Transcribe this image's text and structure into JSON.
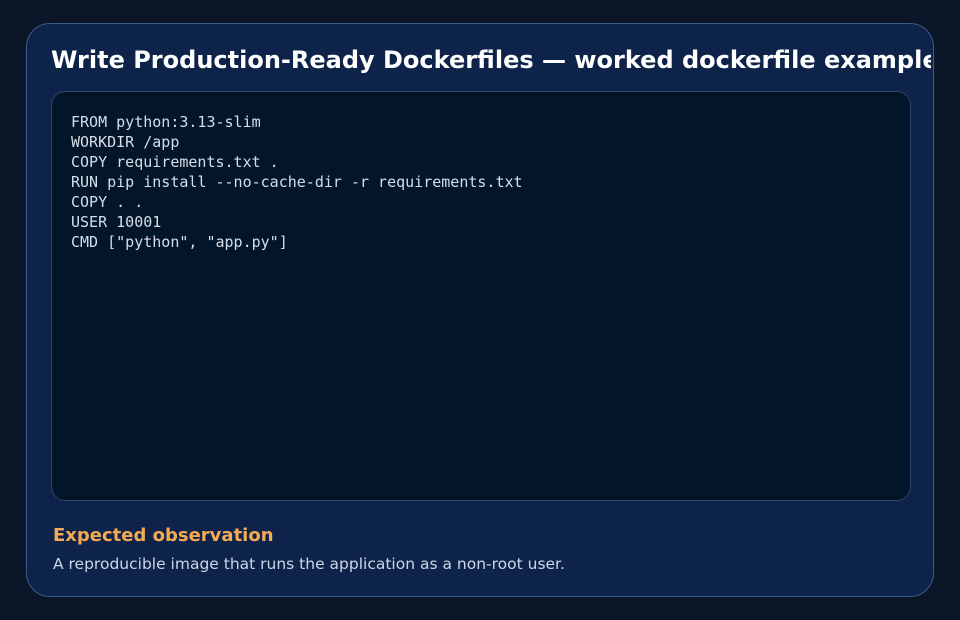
{
  "card": {
    "title": "Write Production-Ready Dockerfiles — worked dockerfile example"
  },
  "code": {
    "lines": [
      "FROM python:3.13-slim",
      "WORKDIR /app",
      "COPY requirements.txt .",
      "RUN pip install --no-cache-dir -r requirements.txt",
      "COPY . .",
      "USER 10001",
      "CMD [\"python\", \"app.py\"]"
    ]
  },
  "observation": {
    "heading": "Expected observation",
    "text": "A reproducible image that runs the application as a non-root user."
  },
  "colors": {
    "page_background": "#0b1729",
    "card_background": "#0e2349",
    "code_background": "#031529",
    "heading_accent": "#f4aa55"
  }
}
